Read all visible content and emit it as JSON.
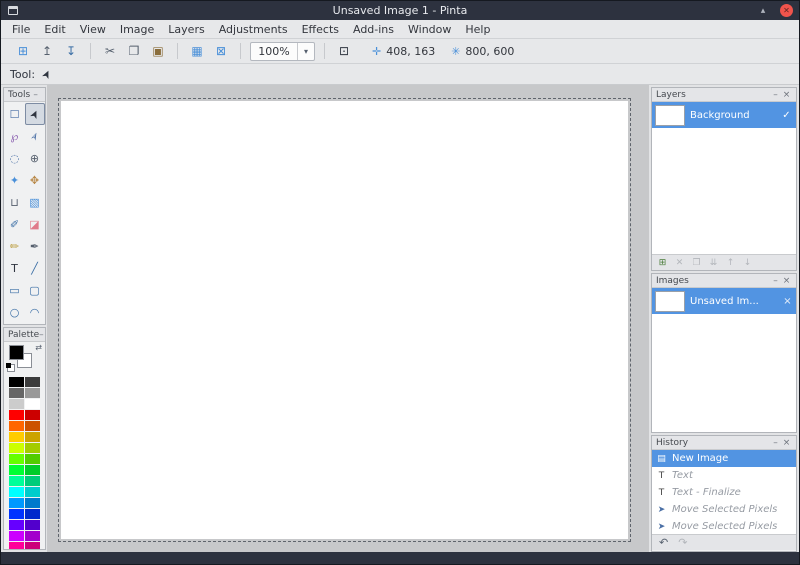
{
  "window": {
    "title": "Unsaved Image 1 - Pinta",
    "maximize_icon": "▴",
    "close_icon": "✕"
  },
  "menu": {
    "items": [
      "File",
      "Edit",
      "View",
      "Image",
      "Layers",
      "Adjustments",
      "Effects",
      "Add-ins",
      "Window",
      "Help"
    ]
  },
  "toolbar": {
    "groups": [
      {
        "items": [
          {
            "name": "new-image",
            "glyph": "⊞",
            "color": "#4a90d9"
          },
          {
            "name": "open-image",
            "glyph": "↥",
            "color": "#56606e"
          },
          {
            "name": "save-image",
            "glyph": "↧",
            "color": "#3a6ea5"
          }
        ]
      },
      {
        "items": [
          {
            "name": "cut",
            "glyph": "✂",
            "color": "#56606e"
          },
          {
            "name": "copy",
            "glyph": "❐",
            "color": "#56606e"
          },
          {
            "name": "paste",
            "glyph": "▣",
            "color": "#8a6d3b"
          }
        ]
      },
      {
        "items": [
          {
            "name": "crop-to-selection",
            "glyph": "▦",
            "color": "#4a90d9"
          },
          {
            "name": "deselect",
            "glyph": "⊠",
            "color": "#4a90d9"
          }
        ]
      }
    ],
    "zoom": {
      "value": "100%",
      "dropdown_icon": "▾"
    },
    "actual_size_icon": "⊡",
    "cursor_position": {
      "icon": "✛",
      "value": "408, 163"
    },
    "image_size": {
      "icon": "✳",
      "value": "800, 600"
    }
  },
  "tool_row": {
    "label": "Tool:",
    "current_tool_icon": "➤"
  },
  "tools_panel": {
    "title": "Tools",
    "collapse_icon": "–",
    "tools": [
      {
        "name": "rectangle-select-tool",
        "glyph": "☐",
        "color": "#4a6fa5"
      },
      {
        "name": "move-selected-tool",
        "glyph": "➤",
        "color": "#2f3540",
        "selected": true,
        "cursor": true
      },
      {
        "name": "lasso-select-tool",
        "glyph": "℘",
        "color": "#8a5fb0"
      },
      {
        "name": "move-selection-tool",
        "glyph": "➢",
        "color": "#4a6fa5",
        "cursor": true
      },
      {
        "name": "ellipse-select-tool",
        "glyph": "◌",
        "color": "#4a6fa5"
      },
      {
        "name": "zoom-tool",
        "glyph": "⊕",
        "color": "#56606e"
      },
      {
        "name": "magic-wand-tool",
        "glyph": "✦",
        "color": "#4a90d9"
      },
      {
        "name": "pan-tool",
        "glyph": "✥",
        "color": "#b98a4a"
      },
      {
        "name": "paint-bucket-tool",
        "glyph": "⊔",
        "color": "#56606e"
      },
      {
        "name": "gradient-tool",
        "glyph": "▧",
        "color": "#4a90d9"
      },
      {
        "name": "paintbrush-tool",
        "glyph": "✐",
        "color": "#3a6ea5"
      },
      {
        "name": "eraser-tool",
        "glyph": "◪",
        "color": "#e07a8a"
      },
      {
        "name": "pencil-tool",
        "glyph": "✏",
        "color": "#b99a3a"
      },
      {
        "name": "color-picker-tool",
        "glyph": "✒",
        "color": "#56606e"
      },
      {
        "name": "text-tool",
        "glyph": "T",
        "color": "#2f3540"
      },
      {
        "name": "line-curve-tool",
        "glyph": "╱",
        "color": "#3a6ea5"
      },
      {
        "name": "rectangle-tool",
        "glyph": "▭",
        "color": "#3a6ea5"
      },
      {
        "name": "rounded-rectangle-tool",
        "glyph": "▢",
        "color": "#3a6ea5"
      },
      {
        "name": "ellipse-tool",
        "glyph": "○",
        "color": "#3a6ea5"
      },
      {
        "name": "freeform-shape-tool",
        "glyph": "◠",
        "color": "#3a6ea5"
      }
    ]
  },
  "palette_panel": {
    "title": "Palette",
    "collapse_icon": "–",
    "primary": "#000000",
    "secondary": "#ffffff",
    "swap_icon": "⇄",
    "swatches": [
      [
        "#000000",
        "#3c3c3c"
      ],
      [
        "#666666",
        "#999999"
      ],
      [
        "#cccccc",
        "#ffffff"
      ],
      [
        "#ff0000",
        "#cc0000"
      ],
      [
        "#ff6600",
        "#cc5200"
      ],
      [
        "#ffcc00",
        "#cca300"
      ],
      [
        "#ccff00",
        "#a3cc00"
      ],
      [
        "#66ff00",
        "#52cc00"
      ],
      [
        "#00ff33",
        "#00cc29"
      ],
      [
        "#00ff99",
        "#00cc7a"
      ],
      [
        "#00ffff",
        "#00cccc"
      ],
      [
        "#0099ff",
        "#007acc"
      ],
      [
        "#0033ff",
        "#0029cc"
      ],
      [
        "#6600ff",
        "#5200cc"
      ],
      [
        "#cc00ff",
        "#a300cc"
      ],
      [
        "#ff0099",
        "#cc007a"
      ]
    ]
  },
  "layers_panel": {
    "title": "Layers",
    "min_icon": "–",
    "close_icon": "×",
    "layers": [
      {
        "name": "Background",
        "visible": true,
        "selected": true
      }
    ],
    "buttons": [
      {
        "name": "add-layer-button",
        "glyph": "⊞",
        "enabled": true
      },
      {
        "name": "delete-layer-button",
        "glyph": "✕",
        "enabled": false
      },
      {
        "name": "duplicate-layer-button",
        "glyph": "❐",
        "enabled": false
      },
      {
        "name": "merge-layer-down-button",
        "glyph": "⇊",
        "enabled": false
      },
      {
        "name": "move-layer-up-button",
        "glyph": "↑",
        "enabled": false
      },
      {
        "name": "move-layer-down-button",
        "glyph": "↓",
        "enabled": false
      }
    ]
  },
  "images_panel": {
    "title": "Images",
    "min_icon": "–",
    "close_icon": "×",
    "images": [
      {
        "name": "Unsaved Im...",
        "selected": true,
        "close_icon": "×"
      }
    ]
  },
  "history_panel": {
    "title": "History",
    "min_icon": "–",
    "close_icon": "×",
    "entries": [
      {
        "label": "New Image",
        "icon": "▤",
        "icon_color": "#4a90d9",
        "state": "current"
      },
      {
        "label": "Text",
        "icon": "T",
        "icon_color": "#444444",
        "state": "undone"
      },
      {
        "label": "Text - Finalize",
        "icon": "T",
        "icon_color": "#444444",
        "state": "undone"
      },
      {
        "label": "Move Selected Pixels",
        "icon": "➤",
        "icon_color": "#4a6fa5",
        "state": "undone"
      },
      {
        "label": "Move Selected Pixels",
        "icon": "➤",
        "icon_color": "#4a6fa5",
        "state": "undone"
      }
    ],
    "undo_icon": "↶",
    "redo_icon": "↷"
  },
  "colors": {
    "accent": "#5294e2",
    "close_button": "#f0544c",
    "titlebar": "#2d323f"
  }
}
